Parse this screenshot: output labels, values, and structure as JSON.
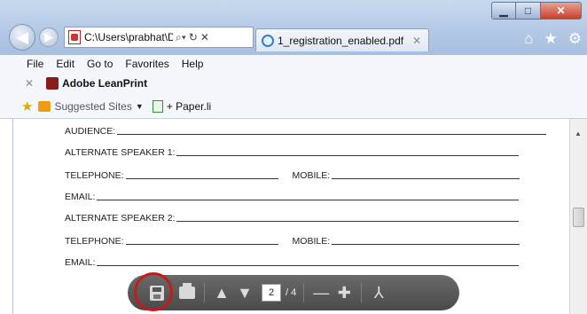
{
  "window": {
    "controls": {
      "minimize": "▁",
      "maximize": "□",
      "close": "✕"
    }
  },
  "nav": {
    "back_icon": "back-arrow-icon",
    "forward_icon": "forward-arrow-icon"
  },
  "address": {
    "text": "C:\\Users\\prabhat\\D",
    "search_glyph": "⌕▾",
    "refresh_glyph": "↻",
    "stop_glyph": "✕"
  },
  "tab": {
    "title": "1_registration_enabled.pdf",
    "close_glyph": "✕"
  },
  "toolbar_icons": {
    "home": "⌂",
    "favorites": "★",
    "settings": "⚙"
  },
  "menu": [
    "File",
    "Edit",
    "Go to",
    "Favorites",
    "Help"
  ],
  "leanprint": {
    "close_glyph": "✕",
    "label": "Adobe LeanPrint"
  },
  "favorites_bar": {
    "suggested": "Suggested Sites",
    "paper": "+ Paper.li"
  },
  "form": {
    "audience": "AUDIENCE:",
    "alt1": "ALTERNATE SPEAKER 1:",
    "tel1": "TELEPHONE:",
    "mobile1": "MOBILE:",
    "email1": "EMAIL:",
    "alt2": "ALTERNATE SPEAKER 2:",
    "tel2": "TELEPHONE:",
    "mobile2": "MOBILE:",
    "email2": "EMAIL:"
  },
  "pdf_toolbar": {
    "current_page": "2",
    "total_pages": "/ 4",
    "prev_glyph": "▲",
    "next_glyph": "▼",
    "zoom_out": "—",
    "zoom_in": "✚",
    "acrobat": "⅄"
  }
}
